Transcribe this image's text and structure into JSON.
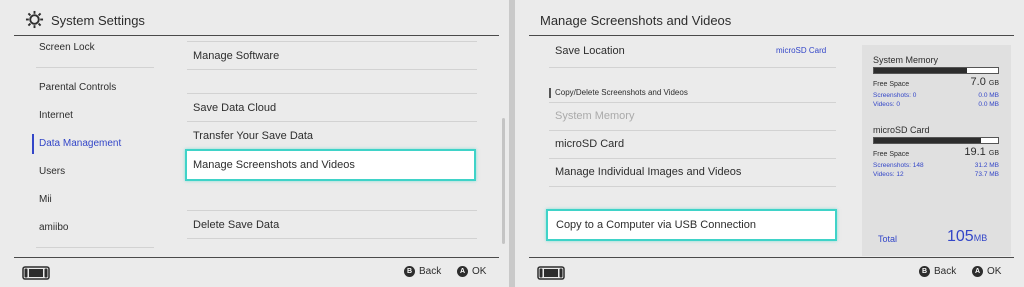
{
  "left_panel": {
    "title": "System Settings",
    "icon": "gear-icon",
    "sidebar": {
      "items": [
        {
          "label": "Screen Lock"
        },
        {
          "label": "Parental Controls"
        },
        {
          "label": "Internet"
        },
        {
          "label": "Data Management",
          "active": true
        },
        {
          "label": "Users"
        },
        {
          "label": "Mii"
        },
        {
          "label": "amiibo"
        }
      ]
    },
    "menu": {
      "items": [
        {
          "label": "Manage Software"
        },
        {
          "label": "Save Data Cloud"
        },
        {
          "label": "Transfer Your Save Data"
        },
        {
          "label": "Manage Screenshots and Videos",
          "selected": true
        },
        {
          "label": "Delete Save Data"
        }
      ]
    },
    "footer": {
      "console_icon": "console-icon",
      "back_label": "Back",
      "ok_label": "OK",
      "back_glyph": "B",
      "ok_glyph": "A"
    }
  },
  "right_panel": {
    "title": "Manage Screenshots and Videos",
    "save_location": {
      "label": "Save Location",
      "value": "microSD Card"
    },
    "section_label": "Copy/Delete Screenshots and Videos",
    "items": [
      {
        "label": "System Memory",
        "disabled": true
      },
      {
        "label": "microSD Card"
      },
      {
        "label": "Manage Individual Images and Videos"
      },
      {
        "label": "Copy to a Computer via USB Connection",
        "selected": true
      }
    ],
    "memory": {
      "system": {
        "title": "System Memory",
        "fill_fraction": 0.75,
        "free_label": "Free Space",
        "free_value": "7.0",
        "free_unit": "GB",
        "screenshots_label": "Screenshots: 0",
        "screenshots_value": "0.0 MB",
        "videos_label": "Videos: 0",
        "videos_value": "0.0 MB"
      },
      "sd": {
        "title": "microSD Card",
        "fill_fraction": 0.86,
        "free_label": "Free Space",
        "free_value": "19.1",
        "free_unit": "GB",
        "screenshots_label": "Screenshots: 148",
        "screenshots_value": "31.2 MB",
        "videos_label": "Videos: 12",
        "videos_value": "73.7 MB"
      },
      "total_label": "Total",
      "total_value": "105",
      "total_unit": "MB"
    },
    "footer": {
      "back_label": "Back",
      "ok_label": "OK",
      "back_glyph": "B",
      "ok_glyph": "A"
    }
  },
  "colors": {
    "accent": "#3346c8",
    "selection": "#3fd3c8",
    "background": "#ebebeb"
  }
}
